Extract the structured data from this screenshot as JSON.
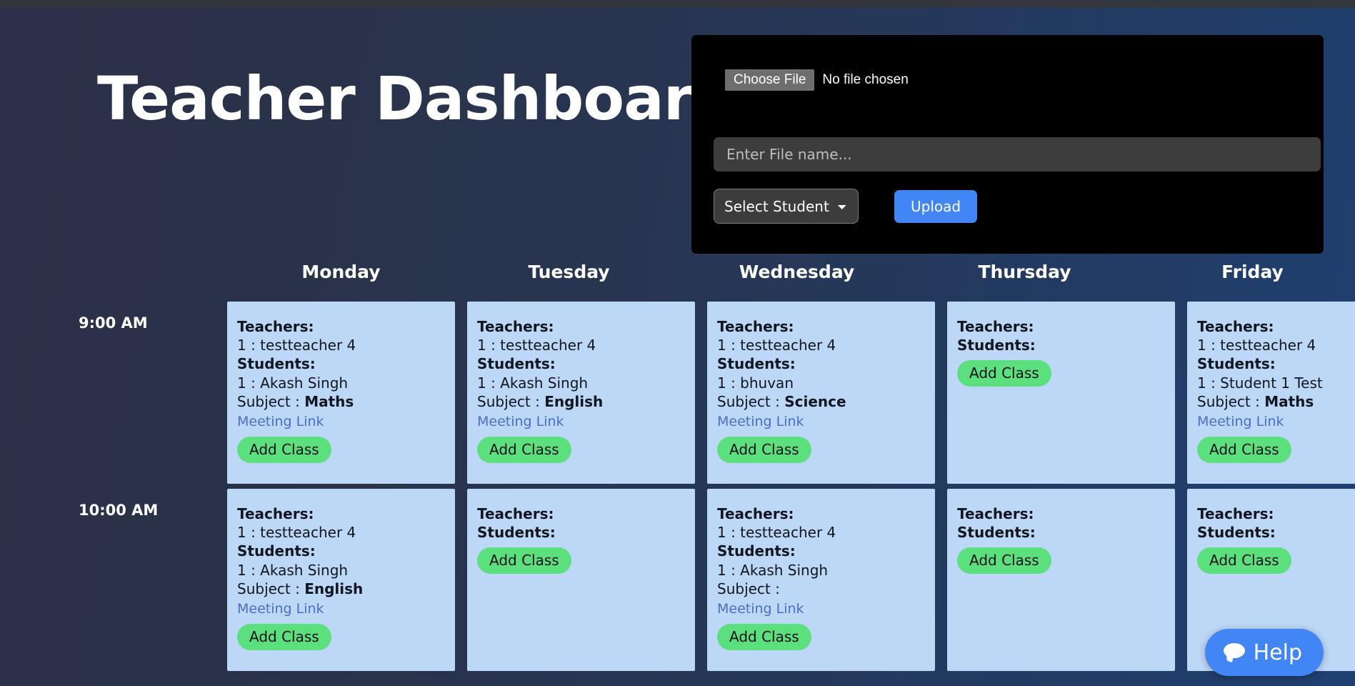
{
  "page": {
    "title": "Teacher Dashboard",
    "accent_blue": "#4285f4",
    "cell_blue": "#bdd7f7",
    "add_class_green": "#5ce07e",
    "link_blue": "#4a6fc4"
  },
  "upload": {
    "choose_file_label": "Choose File",
    "no_file_text": "No file chosen",
    "file_name_placeholder": "Enter File name...",
    "file_name_value": "",
    "select_student_selected": "Select Student",
    "select_student_options": [
      "Select Student"
    ],
    "upload_label": "Upload"
  },
  "calendar": {
    "days": [
      "Monday",
      "Tuesday",
      "Wednesday",
      "Thursday",
      "Friday"
    ],
    "times": [
      "9:00 AM",
      "10:00 AM"
    ],
    "labels": {
      "teachers": "Teachers:",
      "students": "Students:",
      "subject_prefix": "Subject : ",
      "meeting_link": "Meeting Link",
      "add_class": "Add Class"
    },
    "rows": [
      {
        "time": "9:00 AM",
        "cells": [
          {
            "teachers": "1 : testteacher 4",
            "students": "1 : Akash Singh",
            "subject": "Maths",
            "has_subject": true,
            "has_link": true
          },
          {
            "teachers": "1 : testteacher 4",
            "students": "1 : Akash Singh",
            "subject": "English",
            "has_subject": true,
            "has_link": true
          },
          {
            "teachers": "1 : testteacher 4",
            "students": "1 : bhuvan",
            "subject": "Science",
            "has_subject": true,
            "has_link": true
          },
          {
            "teachers": "",
            "students": "",
            "subject": "",
            "has_subject": false,
            "has_link": false
          },
          {
            "teachers": "1 : testteacher 4",
            "students": "1 : Student 1 Test",
            "subject": "Maths",
            "has_subject": true,
            "has_link": true
          }
        ]
      },
      {
        "time": "10:00 AM",
        "cells": [
          {
            "teachers": "1 : testteacher 4",
            "students": "1 : Akash Singh",
            "subject": "English",
            "has_subject": true,
            "has_link": true
          },
          {
            "teachers": "",
            "students": "",
            "subject": "",
            "has_subject": false,
            "has_link": false
          },
          {
            "teachers": "1 : testteacher 4",
            "students": "1 : Akash Singh",
            "subject": "",
            "has_subject": true,
            "has_link": true
          },
          {
            "teachers": "",
            "students": "",
            "subject": "",
            "has_subject": false,
            "has_link": false
          },
          {
            "teachers": "",
            "students": "",
            "subject": "",
            "has_subject": false,
            "has_link": false
          }
        ]
      }
    ]
  },
  "help_widget": {
    "label": "Help",
    "icon": "chat-bubble-icon"
  }
}
